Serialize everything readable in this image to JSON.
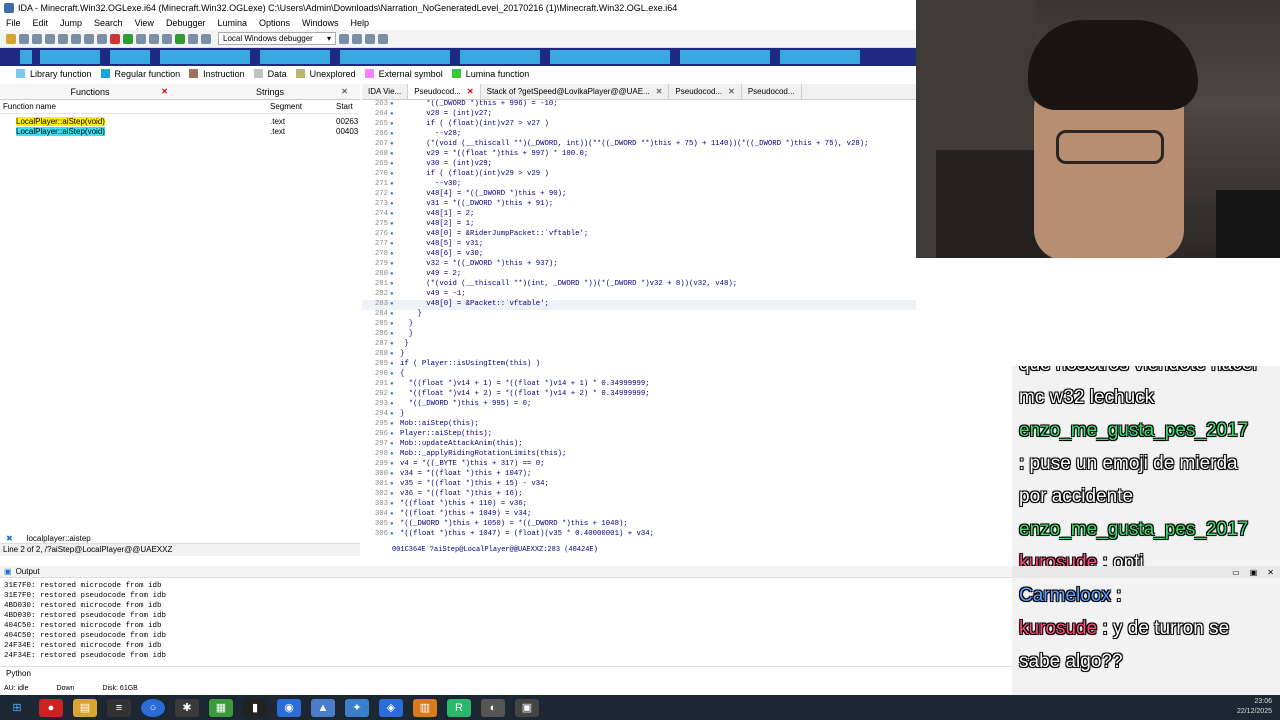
{
  "window": {
    "title": "IDA - Minecraft.Win32.OGLexe.i64 (Minecraft.Win32.OGLexe) C:\\Users\\Admin\\Downloads\\Narration_NoGeneratedLevel_20170216 (1)\\Minecraft.Win32.OGL.exe.i64"
  },
  "menu": [
    "File",
    "Edit",
    "Jump",
    "Search",
    "View",
    "Debugger",
    "Lumina",
    "Options",
    "Windows",
    "Help"
  ],
  "toolbar": {
    "debugger": "Local Windows debugger"
  },
  "legend": [
    {
      "label": "Library function",
      "color": "#7ec8f0"
    },
    {
      "label": "Regular function",
      "color": "#1fa3e0"
    },
    {
      "label": "Instruction",
      "color": "#a07060"
    },
    {
      "label": "Data",
      "color": "#c0c0c0"
    },
    {
      "label": "Unexplored",
      "color": "#b8b868"
    },
    {
      "label": "External symbol",
      "color": "#ff80ff"
    },
    {
      "label": "Lumina function",
      "color": "#33cc33"
    }
  ],
  "left_panel": {
    "tab_functions": "Functions",
    "tab_strings": "Strings",
    "col_name": "Function name",
    "col_segment": "Segment",
    "col_start": "Start",
    "rows": [
      {
        "name": "LocalPlayer::aiStep(void)",
        "segment": ".text",
        "start": "00263"
      },
      {
        "name": "LocalPlayer::aiStep(void)",
        "segment": ".text",
        "start": "00403"
      }
    ],
    "search": "localplayer::aistep",
    "line_info": "Line 2 of 2, /?aiStep@LocalPlayer@@UAEXXZ"
  },
  "code_tabs": [
    "IDA Vie...",
    "Pseudocod...",
    "Stack of ?getSpeed@LovikaPlayer@@UAE...",
    "Pseudocod...",
    "Pseudocod..."
  ],
  "code_lines": [
    {
      "n": "263",
      "t": "      *((_DWORD *)this + 996) = -10;"
    },
    {
      "n": "264",
      "t": "      v28 = (int)v27;"
    },
    {
      "n": "265",
      "t": "      if ( (float)(int)v27 > v27 )"
    },
    {
      "n": "266",
      "t": "        --v28;"
    },
    {
      "n": "267",
      "t": "      (*(void (__thiscall **)(_DWORD, int))(**((_DWORD **)this + 75) + 1140))(*((_DWORD *)this + 75), v28);"
    },
    {
      "n": "268",
      "t": "      v29 = *((float *)this + 997) * 100.0;"
    },
    {
      "n": "269",
      "t": "      v30 = (int)v29;"
    },
    {
      "n": "270",
      "t": "      if ( (float)(int)v29 > v29 )"
    },
    {
      "n": "271",
      "t": "        --v30;"
    },
    {
      "n": "272",
      "t": "      v48[4] = *((_DWORD *)this + 90);"
    },
    {
      "n": "273",
      "t": "      v31 = *((_DWORD *)this + 91);"
    },
    {
      "n": "274",
      "t": "      v48[1] = 2;"
    },
    {
      "n": "275",
      "t": "      v48[2] = 1;"
    },
    {
      "n": "276",
      "t": "      v48[0] = &RiderJumpPacket::`vftable';"
    },
    {
      "n": "277",
      "t": "      v48[5] = v31;"
    },
    {
      "n": "278",
      "t": "      v48[6] = v30;"
    },
    {
      "n": "279",
      "t": "      v32 = *((_DWORD *)this + 937);"
    },
    {
      "n": "280",
      "t": "      v49 = 2;"
    },
    {
      "n": "281",
      "t": "      (*(void (__thiscall **)(int, _DWORD *))(*(_DWORD *)v32 + 8))(v32, v48);"
    },
    {
      "n": "282",
      "t": "      v49 = -1;"
    },
    {
      "n": "283",
      "t": "      v48[0] = &Packet::`vftable';"
    },
    {
      "n": "284",
      "t": "    }"
    },
    {
      "n": "285",
      "t": "  }"
    },
    {
      "n": "286",
      "t": "  }"
    },
    {
      "n": "287",
      "t": " }"
    },
    {
      "n": "288",
      "t": "}"
    },
    {
      "n": "289",
      "t": "if ( Player::isUsingItem(this) )"
    },
    {
      "n": "290",
      "t": "{"
    },
    {
      "n": "291",
      "t": "  *((float *)v14 + 1) = *((float *)v14 + 1) * 0.34999999;"
    },
    {
      "n": "292",
      "t": "  *((float *)v14 + 2) = *((float *)v14 + 2) * 0.34999999;"
    },
    {
      "n": "293",
      "t": "  *((_DWORD *)this + 995) = 0;"
    },
    {
      "n": "294",
      "t": "}"
    },
    {
      "n": "295",
      "t": "Mob::aiStep(this);"
    },
    {
      "n": "296",
      "t": "Player::aiStep(this);"
    },
    {
      "n": "297",
      "t": "Mob::updateAttackAnim(this);"
    },
    {
      "n": "298",
      "t": "Mob::_applyRidingRotationLimits(this);"
    },
    {
      "n": "299",
      "t": "v4 = *((_BYTE *)this + 317) == 0;"
    },
    {
      "n": "300",
      "t": "v34 = *((float *)this + 1047);"
    },
    {
      "n": "301",
      "t": "v35 = *((float *)this + 15) - v34;"
    },
    {
      "n": "302",
      "t": "v36 = *((float *)this + 16);"
    },
    {
      "n": "303",
      "t": "*((float *)this + 110) = v36;"
    },
    {
      "n": "304",
      "t": "*((float *)this + 1049) = v34;"
    },
    {
      "n": "305",
      "t": "*((_DWORD *)this + 1050) = *((_DWORD *)this + 1048);"
    },
    {
      "n": "306",
      "t": "*((float *)this + 1047) = (float)(v35 * 0.40000001) + v34;"
    }
  ],
  "code_status": "001C364E ?aiStep@LocalPlayer@@UAEXXZ:283 (40424E)",
  "output": {
    "title": "Output",
    "lines": [
      "31E7F0: restored microcode from idb",
      "31E7F0: restored pseudocode from idb",
      "4BD030: restored microcode from idb",
      "4BD030: restored pseudocode from idb",
      "404C50: restored microcode from idb",
      "404C50: restored pseudocode from idb",
      "24F34E: restored microcode from idb",
      "24F34E: restored pseudocode from idb"
    ],
    "python": "Python"
  },
  "statusbar": {
    "au": "AU:  idle",
    "dir": "Down",
    "disk": "Disk: 61GB"
  },
  "chat": [
    {
      "user": "",
      "text": "que nosotros viendote hacer",
      "ucolor": "#ffffff"
    },
    {
      "user": "",
      "text": "mc w32 lechuck",
      "ucolor": "#ffffff"
    },
    {
      "user": "enzo_me_gusta_pes_2017",
      "text": "",
      "ucolor": "#3cdc6e"
    },
    {
      "user": "",
      "text": ": puse un emoji de mierda",
      "ucolor": "#ffffff"
    },
    {
      "user": "",
      "text": "por accidente",
      "ucolor": "#ffffff"
    },
    {
      "user": "enzo_me_gusta_pes_2017",
      "text": "",
      "ucolor": "#3cdc6e"
    },
    {
      "user": "kurosude",
      "text": " :  opti",
      "ucolor": "#ff4a7a"
    },
    {
      "user": "Carmeloox",
      "text": " : ",
      "ucolor": "#5aa0ff"
    },
    {
      "user": "kurosude",
      "text": " : y de turron se",
      "ucolor": "#ff4a7a"
    },
    {
      "user": "",
      "text": "sabe algo??",
      "ucolor": "#ffffff"
    }
  ],
  "clock": {
    "time": "23:06",
    "date": "22/12/2025"
  }
}
